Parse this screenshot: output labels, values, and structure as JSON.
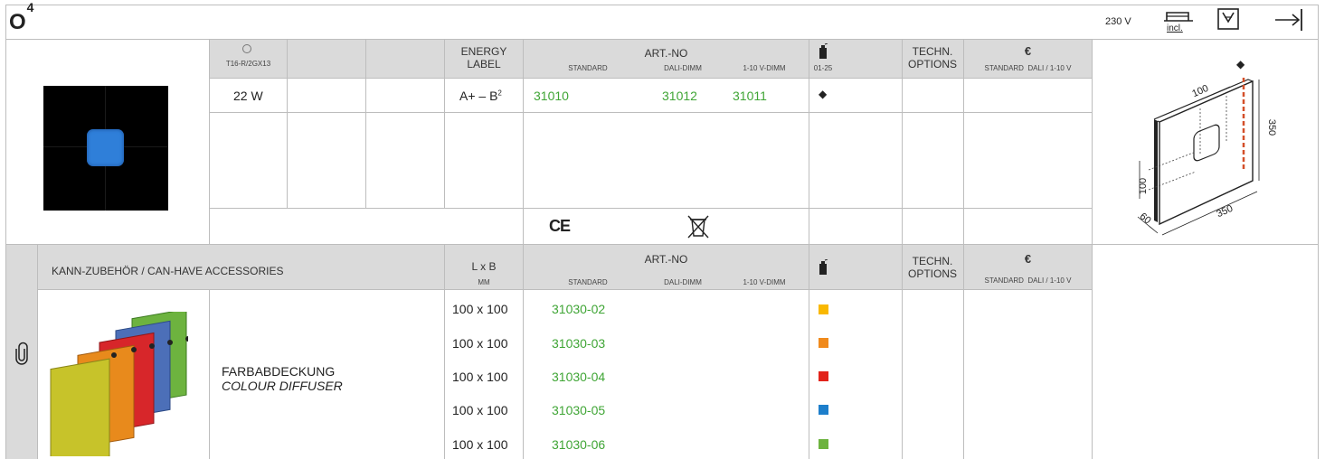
{
  "title": {
    "main": "O",
    "sup": "4"
  },
  "header_right": {
    "voltage": "230 V",
    "incl": "incl."
  },
  "top_table": {
    "lamp_type": "T16-R/2GX13",
    "energy_label": "ENERGY LABEL",
    "art_no": "ART.-NO",
    "art_sub": {
      "standard": "STANDARD",
      "dali": "DALI-DIMM",
      "v110": "1-10 V-DIMM"
    },
    "pkg_sub": "01-25",
    "techn": "TECHN. OPTIONS",
    "euro": "€",
    "euro_sub": "STANDARD  DALI / 1-10 V",
    "row": {
      "watt": "22 W",
      "energy": "A+ – B",
      "energy_sup": "2",
      "standard": "31010",
      "dali": "31012",
      "v110": "31011",
      "pkg_mark": "◆"
    },
    "ce": "CE"
  },
  "dimensions": {
    "h100": "100",
    "w350": "350",
    "h350": "350",
    "v100": "100",
    "d60": "60",
    "marker": "◆"
  },
  "accessories": {
    "heading": "KANN-ZUBEHÖR / CAN-HAVE ACCESSORIES",
    "lxb": "L x B",
    "mm": "MM",
    "art_no": "ART.-NO",
    "art_sub": {
      "standard": "STANDARD",
      "dali": "DALI-DIMM",
      "v110": "1-10 V-DIMM"
    },
    "techn": "TECHN. OPTIONS",
    "euro": "€",
    "euro_sub": "STANDARD  DALI / 1-10 V",
    "name_de": "FARBABDECKUNG",
    "name_en": "COLOUR DIFFUSER",
    "rows": [
      {
        "size": "100 x 100",
        "art": "31030-02",
        "color": "#f9b800"
      },
      {
        "size": "100 x 100",
        "art": "31030-03",
        "color": "#f08a1c"
      },
      {
        "size": "100 x 100",
        "art": "31030-04",
        "color": "#e2231a"
      },
      {
        "size": "100 x 100",
        "art": "31030-05",
        "color": "#1d7ecb"
      },
      {
        "size": "100 x 100",
        "art": "31030-06",
        "color": "#6db33f"
      }
    ]
  }
}
